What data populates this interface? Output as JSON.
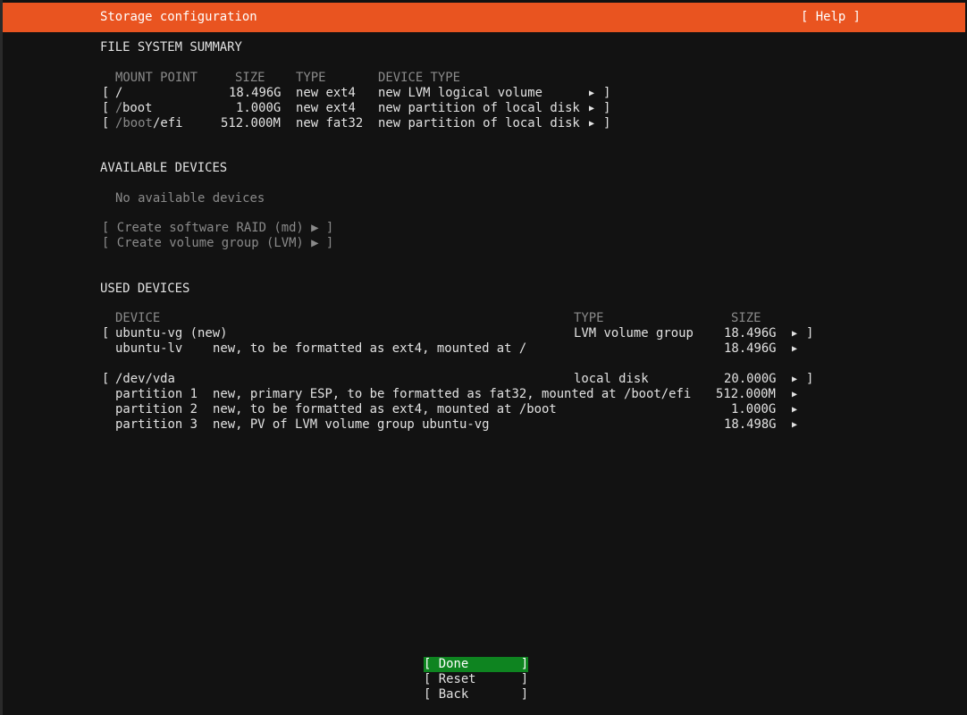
{
  "header": {
    "title": "Storage configuration",
    "help": "[ Help ]"
  },
  "fs_summary": {
    "title": "FILE SYSTEM SUMMARY",
    "columns": [
      "MOUNT POINT",
      "SIZE",
      "TYPE",
      "DEVICE TYPE"
    ],
    "rows": [
      {
        "open": "[",
        "mount_dim": "",
        "mount": "/",
        "size": "18.496G",
        "type": "new ext4",
        "device_type": "new LVM logical volume",
        "arrow": "▶",
        "close": "]"
      },
      {
        "open": "[",
        "mount_dim": "/",
        "mount": "boot",
        "size": "1.000G",
        "type": "new ext4",
        "device_type": "new partition of local disk",
        "arrow": "▶",
        "close": "]"
      },
      {
        "open": "[",
        "mount_dim": "/boot",
        "mount": "/efi",
        "size": "512.000M",
        "type": "new fat32",
        "device_type": "new partition of local disk",
        "arrow": "▶",
        "close": "]"
      }
    ]
  },
  "available": {
    "title": "AVAILABLE DEVICES",
    "empty": "No available devices",
    "actions": [
      "[ Create software RAID (md) ▶ ]",
      "[ Create volume group (LVM) ▶ ]"
    ]
  },
  "used": {
    "title": "USED DEVICES",
    "columns": [
      "DEVICE",
      "TYPE",
      "SIZE"
    ],
    "groups": [
      {
        "open": "[",
        "device": "ubuntu-vg (new)",
        "type": "LVM volume group",
        "size": "18.496G",
        "arrow": "▶",
        "close": "]",
        "children": [
          {
            "name": "ubuntu-lv",
            "desc": "new, to be formatted as ext4, mounted at /",
            "size": "18.496G",
            "arrow": "▶"
          }
        ]
      },
      {
        "open": "[",
        "device": "/dev/vda",
        "type": "local disk",
        "size": "20.000G",
        "arrow": "▶",
        "close": "]",
        "children": [
          {
            "name": "partition 1",
            "desc": "new, primary ESP, to be formatted as fat32, mounted at /boot/efi",
            "size": "512.000M",
            "arrow": "▶"
          },
          {
            "name": "partition 2",
            "desc": "new, to be formatted as ext4, mounted at /boot",
            "size": "1.000G",
            "arrow": "▶"
          },
          {
            "name": "partition 3",
            "desc": "new, PV of LVM volume group ubuntu-vg",
            "size": "18.498G",
            "arrow": "▶"
          }
        ]
      }
    ]
  },
  "buttons": {
    "done": "[ Done       ]",
    "reset": "[ Reset      ]",
    "back": "[ Back       ]"
  },
  "colors": {
    "accent": "#e95420",
    "selected_button": "#0e8420",
    "background": "#121212",
    "text": "#e2e2e2",
    "dim_text": "#8a8a8a"
  }
}
